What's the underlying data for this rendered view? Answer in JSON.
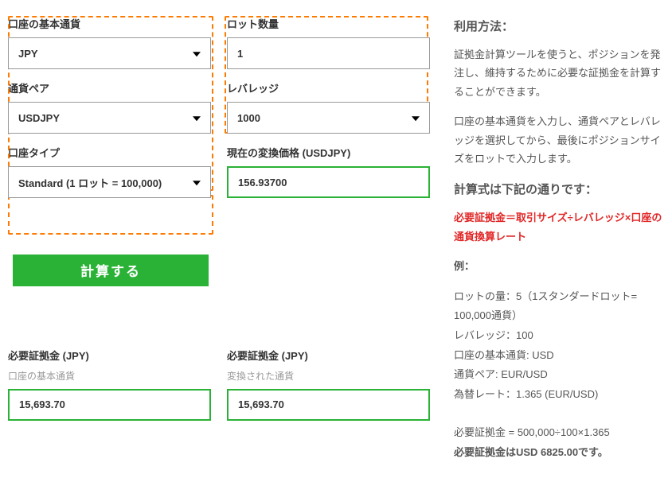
{
  "left": {
    "base_currency": {
      "label": "口座の基本通貨",
      "value": "JPY"
    },
    "currency_pair": {
      "label": "通貨ペア",
      "value": "USDJPY"
    },
    "account_type": {
      "label": "口座タイプ",
      "value": "Standard (1 ロット = 100,000)"
    },
    "calc_button": "計算する"
  },
  "right": {
    "lot_size": {
      "label": "ロット数量",
      "value": "1"
    },
    "leverage": {
      "label": "レバレッジ",
      "value": "1000"
    },
    "conversion_price": {
      "label": "現在の変換価格 (USDJPY)",
      "value": "156.93700"
    }
  },
  "results": {
    "reqA": {
      "label": "必要証拠金 (JPY)",
      "sub": "口座の基本通貨",
      "value": "15,693.70"
    },
    "reqB": {
      "label": "必要証拠金 (JPY)",
      "sub": "変換された通貨",
      "value": "15,693.70"
    }
  },
  "info": {
    "usage_title": "利用方法：",
    "usage_p1": "証拠金計算ツールを使うと、ポジションを発注し、維持するために必要な証拠金を計算することができます。",
    "usage_p2": "口座の基本通貨を入力し、通貨ペアとレバレッジを選択してから、最後にポジションサイズをロットで入力します。",
    "formula_title": "計算式は下記の通りです：",
    "formula": "必要証拠金＝取引サイズ÷レバレッジ×口座の通貨換算レート",
    "example_label": "例：",
    "ex_lot": "ロットの量：5（1スタンダードロット= 100,000通貨）",
    "ex_lev": "レバレッジ：100",
    "ex_ccy": "口座の基本通貨: USD",
    "ex_pair": "通貨ペア: EUR/USD",
    "ex_rate": "為替レート：1.365 (EUR/USD)",
    "ex_calc": "必要証拠金 = 500,000÷100×1.365",
    "ex_result": "必要証拠金はUSD 6825.00です。"
  }
}
